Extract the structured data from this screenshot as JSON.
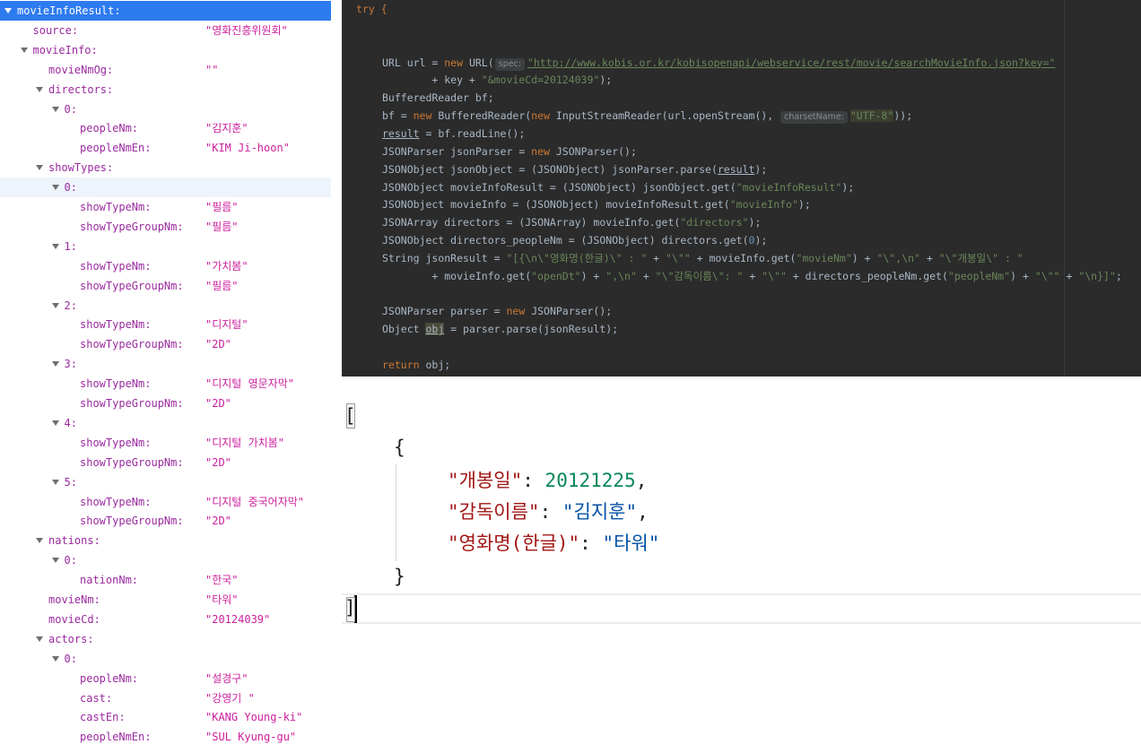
{
  "tree": {
    "rows": [
      {
        "key": "movieInfoResult:",
        "value": "",
        "expandable": true,
        "selected": true
      },
      {
        "key": "source:",
        "value": "\"영화진흥위원회\"",
        "expandable": false
      },
      {
        "key": "movieInfo:",
        "value": "",
        "expandable": true
      },
      {
        "key": "movieNmOg:",
        "value": "\"\"",
        "expandable": false
      },
      {
        "key": "directors:",
        "value": "",
        "expandable": true
      },
      {
        "key": "0:",
        "value": "",
        "expandable": true
      },
      {
        "key": "peopleNm:",
        "value": "\"김지훈\"",
        "expandable": false
      },
      {
        "key": "peopleNmEn:",
        "value": "\"KIM Ji-hoon\"",
        "expandable": false
      },
      {
        "key": "showTypes:",
        "value": "",
        "expandable": true
      },
      {
        "key": "0:",
        "value": "",
        "expandable": true,
        "hovered": true
      },
      {
        "key": "showTypeNm:",
        "value": "\"필름\"",
        "expandable": false
      },
      {
        "key": "showTypeGroupNm:",
        "value": "\"필름\"",
        "expandable": false
      },
      {
        "key": "1:",
        "value": "",
        "expandable": true
      },
      {
        "key": "showTypeNm:",
        "value": "\"가치봄\"",
        "expandable": false
      },
      {
        "key": "showTypeGroupNm:",
        "value": "\"필름\"",
        "expandable": false
      },
      {
        "key": "2:",
        "value": "",
        "expandable": true
      },
      {
        "key": "showTypeNm:",
        "value": "\"디지털\"",
        "expandable": false
      },
      {
        "key": "showTypeGroupNm:",
        "value": "\"2D\"",
        "expandable": false
      },
      {
        "key": "3:",
        "value": "",
        "expandable": true
      },
      {
        "key": "showTypeNm:",
        "value": "\"디지털 영문자막\"",
        "expandable": false
      },
      {
        "key": "showTypeGroupNm:",
        "value": "\"2D\"",
        "expandable": false
      },
      {
        "key": "4:",
        "value": "",
        "expandable": true
      },
      {
        "key": "showTypeNm:",
        "value": "\"디지털 가치봄\"",
        "expandable": false
      },
      {
        "key": "showTypeGroupNm:",
        "value": "\"2D\"",
        "expandable": false
      },
      {
        "key": "5:",
        "value": "",
        "expandable": true
      },
      {
        "key": "showTypeNm:",
        "value": "\"디지털 중국어자막\"",
        "expandable": false
      },
      {
        "key": "showTypeGroupNm:",
        "value": "\"2D\"",
        "expandable": false
      },
      {
        "key": "nations:",
        "value": "",
        "expandable": true
      },
      {
        "key": "0:",
        "value": "",
        "expandable": true
      },
      {
        "key": "nationNm:",
        "value": "\"한국\"",
        "expandable": false
      },
      {
        "key": "movieNm:",
        "value": "\"타워\"",
        "expandable": false
      },
      {
        "key": "movieCd:",
        "value": "\"20124039\"",
        "expandable": false
      },
      {
        "key": "actors:",
        "value": "",
        "expandable": true
      },
      {
        "key": "0:",
        "value": "",
        "expandable": true
      },
      {
        "key": "peopleNm:",
        "value": "\"설경구\"",
        "expandable": false
      },
      {
        "key": "cast:",
        "value": "\"강영기 \"",
        "expandable": false
      },
      {
        "key": "castEn:",
        "value": "\"KANG Young-ki\"",
        "expandable": false
      },
      {
        "key": "peopleNmEn:",
        "value": "\"SUL Kyung-gu\"",
        "expandable": false
      }
    ]
  },
  "code": {
    "lines": [
      [
        {
          "t": "try {",
          "c": "kw-try"
        }
      ],
      [],
      [],
      [
        {
          "t": "URL url = "
        },
        {
          "t": "new",
          "c": "kw"
        },
        {
          "t": " URL("
        },
        {
          "t": "spec:",
          "c": "hint"
        },
        {
          "t": "\"http://www.kobis.or.kr/kobisopenapi/webservice/rest/movie/searchMovieInfo.json?key=\"",
          "c": "url"
        }
      ],
      [
        {
          "t": "        + key + "
        },
        {
          "t": "\"&movieCd=20124039\"",
          "c": "str"
        },
        {
          "t": ");"
        }
      ],
      [
        {
          "t": "BufferedReader bf;"
        }
      ],
      [
        {
          "t": "bf = "
        },
        {
          "t": "new",
          "c": "kw"
        },
        {
          "t": " BufferedReader("
        },
        {
          "t": "new",
          "c": "kw"
        },
        {
          "t": " InputStreamReader(url.openStream(), "
        },
        {
          "t": "charsetName:",
          "c": "hint"
        },
        {
          "t": "\"UTF-8\"",
          "c": "str hl"
        },
        {
          "t": "));"
        }
      ],
      [
        {
          "t": "result",
          "c": "ul"
        },
        {
          "t": " = bf.readLine();"
        }
      ],
      [
        {
          "t": "JSONParser jsonParser = "
        },
        {
          "t": "new",
          "c": "kw"
        },
        {
          "t": " JSONParser();"
        }
      ],
      [
        {
          "t": "JSONObject jsonObject = (JSONObject) jsonParser.parse("
        },
        {
          "t": "result",
          "c": "ul"
        },
        {
          "t": ");"
        }
      ],
      [
        {
          "t": "JSONObject movieInfoResult = (JSONObject) jsonObject.get("
        },
        {
          "t": "\"movieInfoResult\"",
          "c": "str"
        },
        {
          "t": ");"
        }
      ],
      [
        {
          "t": "JSONObject movieInfo = (JSONObject) movieInfoResult.get("
        },
        {
          "t": "\"movieInfo\"",
          "c": "str"
        },
        {
          "t": ");"
        }
      ],
      [
        {
          "t": "JSONArray directors = (JSONArray) movieInfo.get("
        },
        {
          "t": "\"directors\"",
          "c": "str"
        },
        {
          "t": ");"
        }
      ],
      [
        {
          "t": "JSONObject directors_peopleNm = (JSONObject) directors.get("
        },
        {
          "t": "0",
          "c": "num"
        },
        {
          "t": ");"
        }
      ],
      [
        {
          "t": "String jsonResult = "
        },
        {
          "t": "\"[{\\n\\\"영화명(한글)\\\" : \"",
          "c": "str"
        },
        {
          "t": " + "
        },
        {
          "t": "\"\\\"\"",
          "c": "str"
        },
        {
          "t": " + movieInfo.get("
        },
        {
          "t": "\"movieNm\"",
          "c": "str"
        },
        {
          "t": ") + "
        },
        {
          "t": "\"\\\",\\n\"",
          "c": "str"
        },
        {
          "t": " + "
        },
        {
          "t": "\"\\\"개봉일\\\" : \"",
          "c": "str"
        }
      ],
      [
        {
          "t": "        + movieInfo.get("
        },
        {
          "t": "\"openDt\"",
          "c": "str"
        },
        {
          "t": ") + "
        },
        {
          "t": "\",\\n\"",
          "c": "str"
        },
        {
          "t": " + "
        },
        {
          "t": "\"\\\"감독이름\\\": \"",
          "c": "str"
        },
        {
          "t": " + "
        },
        {
          "t": "\"\\\"\"",
          "c": "str"
        },
        {
          "t": " + directors_peopleNm.get("
        },
        {
          "t": "\"peopleNm\"",
          "c": "str"
        },
        {
          "t": ") + "
        },
        {
          "t": "\"\\\"\"",
          "c": "str"
        },
        {
          "t": " + "
        },
        {
          "t": "\"\\n}]\"",
          "c": "str"
        },
        {
          "t": ";"
        }
      ],
      [],
      [
        {
          "t": "JSONParser parser = "
        },
        {
          "t": "new",
          "c": "kw"
        },
        {
          "t": " JSONParser();"
        }
      ],
      [
        {
          "t": "Object "
        },
        {
          "t": "obj",
          "c": "hlobj ul"
        },
        {
          "t": " = parser.parse(jsonResult);"
        }
      ],
      [],
      [
        {
          "t": "return",
          "c": "kw"
        },
        {
          "t": " obj;"
        }
      ]
    ]
  },
  "json_output": {
    "open_bracket": "[",
    "open_brace": "{",
    "entries": [
      {
        "key": "\"개봉일\"",
        "value": "20121225",
        "type": "number",
        "trail": ","
      },
      {
        "key": "\"감독이름\"",
        "value": "\"김지훈\"",
        "type": "string",
        "trail": ","
      },
      {
        "key": "\"영화명(한글)\"",
        "value": "\"타워\"",
        "type": "string",
        "trail": ""
      }
    ],
    "close_brace": "}",
    "close_bracket": "]"
  },
  "colors": {
    "selection": "#2e7bf0",
    "tree_key": "#9a2a9f",
    "tree_value": "#cc1e9c",
    "editor_bg": "#2b2b2b"
  }
}
